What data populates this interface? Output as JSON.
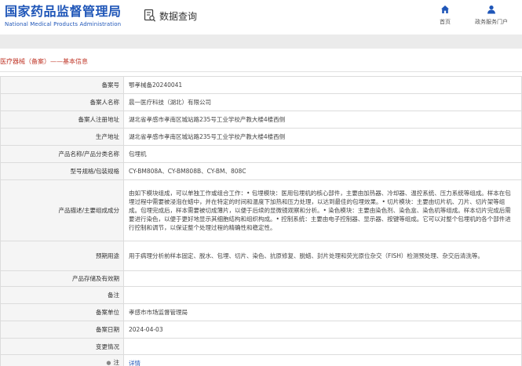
{
  "header": {
    "brand_cn": "国家药品监督管理局",
    "brand_en": "National Medical Products Administration",
    "section_title": "数据查询",
    "nav": {
      "home": "首页",
      "services": "政务服务门户"
    }
  },
  "breadcrumb": "医疗器械（备案）——基本信息",
  "colors": {
    "brand": "#1f56b8",
    "breadcrumb": "#c0392b",
    "label_bg": "#f5f5f5"
  },
  "record": {
    "rows": [
      {
        "label": "备案号",
        "value": "鄂孝械备20240041"
      },
      {
        "label": "备案人名称",
        "value": "晨一医疗科技（湖北）有限公司"
      },
      {
        "label": "备案人注册地址",
        "value": "湖北省孝感市孝南区城站路235号工业学校产教大楼4楼西侧"
      },
      {
        "label": "生产地址",
        "value": "湖北省孝感市孝南区城站路235号工业学校产教大楼4楼西侧"
      },
      {
        "label": "产品名称/产品分类名称",
        "value": "包埋机"
      },
      {
        "label": "型号规格/包装规格",
        "value": "CY-BM808A、CY-BM808B、CY-BM、808C"
      },
      {
        "label": "产品描述/主要组成成分",
        "value": "由如下模块组成，可以单独工作或组合工作：• 包埋模块：医用包埋机的核心部件，主要由加热器、冷却器、温控系统、压力系统等组成。样本在包埋过程中需要被浸泡在蜡中，并在特定的时间和温度下加热和压力处理，以达到最佳的包埋效果。• 切片模块：主要由切片机、刀片、切片架等组成。包埋完成后，样本需要被切成薄片，以便于后续的显微镜观察和分析。• 染色模块：主要由染色剂、染色盒、染色机等组成。样本切片完成后需要进行染色，以便于更好地显示其细胞结构和组织构成。• 控制系统：主要由电子控制器、显示器、按键等组成。它可以对整个包埋机的各个部件进行控制和调节，以保证整个处理过程的精确性和稳定性。"
      },
      {
        "label": "预期用途",
        "value": "用于病理分析前样本固定、脱水、包埋、切片、染色、抗原修复、脱蜡、封片处理和荧光原位杂交（FISH）检测预处理、杂交后清洗等。"
      },
      {
        "label": "产品存储及有效期",
        "value": ""
      },
      {
        "label": "备注",
        "value": ""
      },
      {
        "label": "备案单位",
        "value": "孝感市市场监督管理局"
      },
      {
        "label": "备案日期",
        "value": "2024-04-03"
      },
      {
        "label": "变更情况",
        "value": ""
      },
      {
        "label": "注",
        "value": "详情"
      }
    ]
  }
}
